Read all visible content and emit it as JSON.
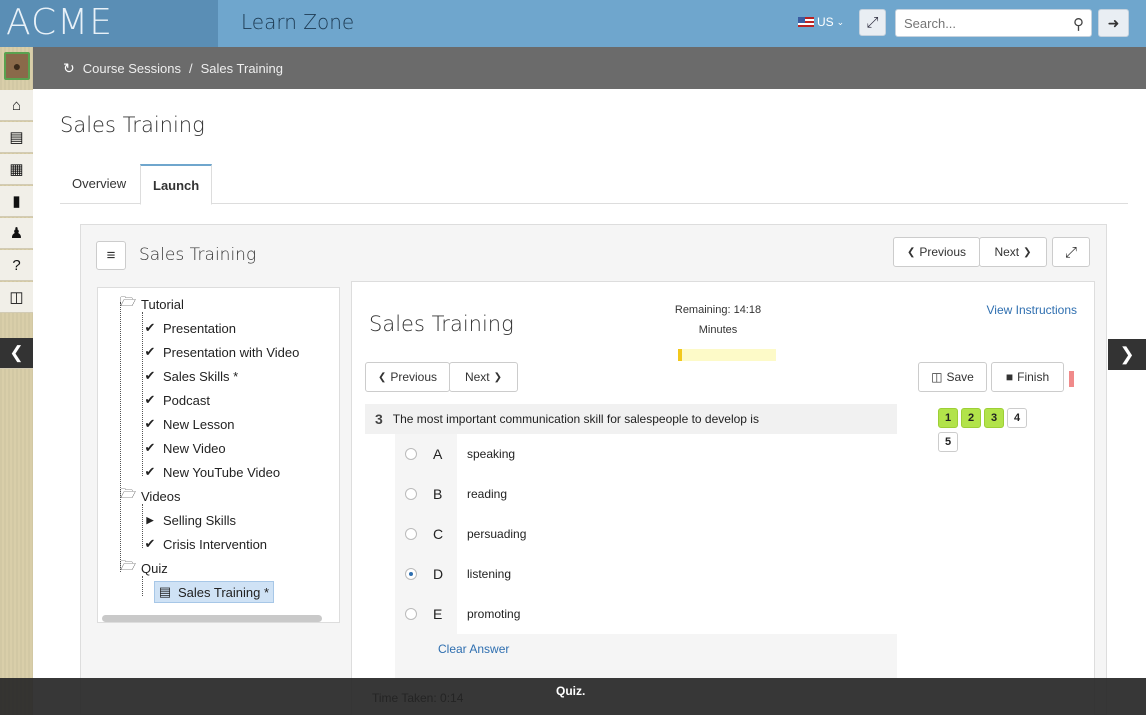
{
  "header": {
    "logo": "ACME",
    "app_title": "Learn Zone",
    "locale": "US",
    "search_placeholder": "Search..."
  },
  "breadcrumb": {
    "root": "Course Sessions",
    "separator": "/",
    "current": "Sales Training"
  },
  "page": {
    "title": "Sales Training"
  },
  "tabs": [
    {
      "label": "Overview",
      "active": false
    },
    {
      "label": "Launch",
      "active": true
    }
  ],
  "panel": {
    "title": "Sales Training",
    "prev_label": "Previous",
    "next_label": "Next"
  },
  "tree": {
    "groups": [
      {
        "label": "Tutorial",
        "items": [
          {
            "label": "Presentation",
            "icon": "check-icon"
          },
          {
            "label": "Presentation with Video",
            "icon": "check-icon"
          },
          {
            "label": "Sales Skills *",
            "icon": "check-icon"
          },
          {
            "label": "Podcast",
            "icon": "check-icon"
          },
          {
            "label": "New Lesson",
            "icon": "check-icon"
          },
          {
            "label": "New Video",
            "icon": "check-icon"
          },
          {
            "label": "New YouTube Video",
            "icon": "check-icon"
          }
        ]
      },
      {
        "label": "Videos",
        "items": [
          {
            "label": "Selling Skills",
            "icon": "youtube-icon"
          },
          {
            "label": "Crisis Intervention",
            "icon": "check-icon"
          }
        ]
      },
      {
        "label": "Quiz",
        "items": [
          {
            "label": "Sales Training *",
            "icon": "list-icon",
            "selected": true
          }
        ]
      }
    ]
  },
  "quiz": {
    "title": "Sales Training",
    "remaining_label": "Remaining: 14:18",
    "remaining_unit": "Minutes",
    "time_progress": 0.04,
    "view_instructions": "View Instructions",
    "prev_label": "Previous",
    "next_label": "Next",
    "save_label": "Save",
    "finish_label": "Finish",
    "question_number": "3",
    "question_text": "The most important communication skill for salespeople to develop is",
    "options": [
      {
        "letter": "A",
        "text": "speaking",
        "selected": false
      },
      {
        "letter": "B",
        "text": "reading",
        "selected": false
      },
      {
        "letter": "C",
        "text": "persuading",
        "selected": false
      },
      {
        "letter": "D",
        "text": "listening",
        "selected": true
      },
      {
        "letter": "E",
        "text": "promoting",
        "selected": false
      }
    ],
    "clear_answer": "Clear Answer",
    "question_pages": [
      {
        "label": "1",
        "answered": true
      },
      {
        "label": "2",
        "answered": true
      },
      {
        "label": "3",
        "answered": true
      },
      {
        "label": "4",
        "answered": false
      },
      {
        "label": "5",
        "answered": false
      }
    ],
    "time_taken": "Time Taken: 0:14"
  },
  "caption": "Quiz.",
  "colors": {
    "topbar": "#6fa6cd",
    "answered": "#b2e34a",
    "link": "#2f6fb0",
    "timer_fill": "#f2c81c"
  }
}
